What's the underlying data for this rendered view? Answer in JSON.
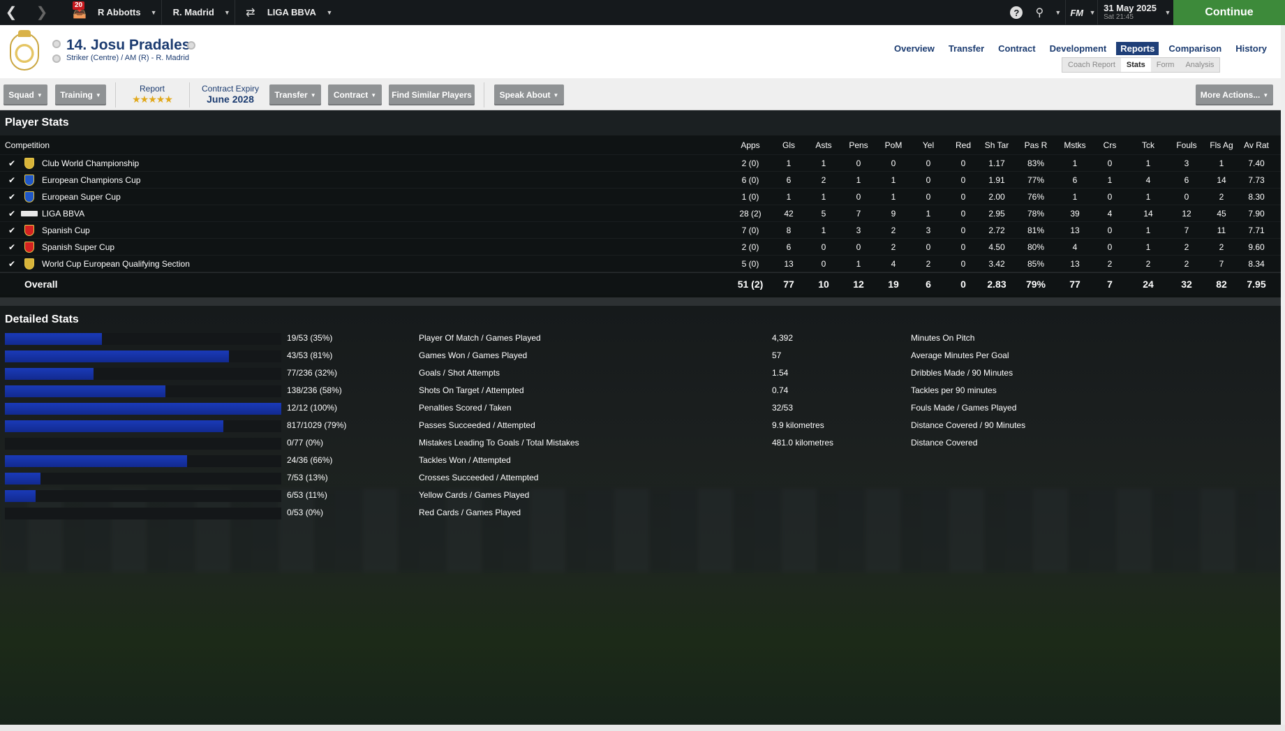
{
  "topbar": {
    "inbox_count": "20",
    "manager": "R Abbotts",
    "club": "R. Madrid",
    "competition": "LIGA BBVA",
    "fm_label": "FM",
    "date": "31 May 2025",
    "time": "Sat 21:45",
    "continue_label": "Continue"
  },
  "player": {
    "name": "14. Josu Pradales",
    "subtitle": "Striker (Centre) / AM (R) - R. Madrid"
  },
  "nav": {
    "overview": "Overview",
    "transfer": "Transfer",
    "contract": "Contract",
    "development": "Development",
    "reports": "Reports",
    "comparison": "Comparison",
    "history": "History"
  },
  "subtabs": {
    "coach_report": "Coach Report",
    "stats": "Stats",
    "form": "Form",
    "analysis": "Analysis"
  },
  "actions": {
    "squad": "Squad",
    "training": "Training",
    "report_label": "Report",
    "report_stars": "★★★★★",
    "contract_expiry_label": "Contract Expiry",
    "contract_expiry_value": "June 2028",
    "transfer": "Transfer",
    "contract": "Contract",
    "find_similar": "Find Similar Players",
    "speak_about": "Speak About",
    "more_actions": "More Actions..."
  },
  "player_stats": {
    "title": "Player Stats",
    "headers": [
      "Competition",
      "Apps",
      "Gls",
      "Asts",
      "Pens",
      "PoM",
      "Yel",
      "Red",
      "Sh Tar",
      "Pas R",
      "Mstks",
      "Crs",
      "Tck",
      "Fouls",
      "Fls Ag",
      "Av Rat"
    ],
    "rows": [
      {
        "name": "Club World Championship",
        "color": "#d8b43a",
        "vals": [
          "2 (0)",
          "1",
          "1",
          "0",
          "0",
          "0",
          "0",
          "1.17",
          "83%",
          "1",
          "0",
          "1",
          "3",
          "1",
          "7.40"
        ]
      },
      {
        "name": "European Champions Cup",
        "color": "#1f57c7",
        "vals": [
          "6 (0)",
          "6",
          "2",
          "1",
          "1",
          "0",
          "0",
          "1.91",
          "77%",
          "6",
          "1",
          "4",
          "6",
          "14",
          "7.73"
        ]
      },
      {
        "name": "European Super Cup",
        "color": "#1f57c7",
        "vals": [
          "1 (0)",
          "1",
          "1",
          "0",
          "1",
          "0",
          "0",
          "2.00",
          "76%",
          "1",
          "0",
          "1",
          "0",
          "2",
          "8.30"
        ]
      },
      {
        "name": "LIGA BBVA",
        "color": "#e8e8e8",
        "vals": [
          "28 (2)",
          "42",
          "5",
          "7",
          "9",
          "1",
          "0",
          "2.95",
          "78%",
          "39",
          "4",
          "14",
          "12",
          "45",
          "7.90"
        ]
      },
      {
        "name": "Spanish Cup",
        "color": "#d42121",
        "vals": [
          "7 (0)",
          "8",
          "1",
          "3",
          "2",
          "3",
          "0",
          "2.72",
          "81%",
          "13",
          "0",
          "1",
          "7",
          "11",
          "7.71"
        ]
      },
      {
        "name": "Spanish Super Cup",
        "color": "#d42121",
        "vals": [
          "2 (0)",
          "6",
          "0",
          "0",
          "2",
          "0",
          "0",
          "4.50",
          "80%",
          "4",
          "0",
          "1",
          "2",
          "2",
          "9.60"
        ]
      },
      {
        "name": "World Cup European Qualifying Section",
        "color": "#d8b43a",
        "vals": [
          "5 (0)",
          "13",
          "0",
          "1",
          "4",
          "2",
          "0",
          "3.42",
          "85%",
          "13",
          "2",
          "2",
          "2",
          "7",
          "8.34"
        ]
      }
    ],
    "overall_label": "Overall",
    "overall": [
      "51 (2)",
      "77",
      "10",
      "12",
      "19",
      "6",
      "0",
      "2.83",
      "79%",
      "77",
      "7",
      "24",
      "32",
      "82",
      "7.95"
    ]
  },
  "detailed_stats": {
    "title": "Detailed Stats",
    "left": [
      {
        "value": "19/53 (35%)",
        "label": "Player Of Match / Games Played",
        "fraction": 0.35
      },
      {
        "value": "43/53 (81%)",
        "label": "Games Won / Games Played",
        "fraction": 0.81
      },
      {
        "value": "77/236 (32%)",
        "label": "Goals / Shot Attempts",
        "fraction": 0.32
      },
      {
        "value": "138/236 (58%)",
        "label": "Shots On Target / Attempted",
        "fraction": 0.58
      },
      {
        "value": "12/12 (100%)",
        "label": "Penalties Scored / Taken",
        "fraction": 1.0
      },
      {
        "value": "817/1029 (79%)",
        "label": "Passes Succeeded / Attempted",
        "fraction": 0.79
      },
      {
        "value": "0/77 (0%)",
        "label": "Mistakes Leading To Goals / Total Mistakes",
        "fraction": 0
      },
      {
        "value": "24/36 (66%)",
        "label": "Tackles Won / Attempted",
        "fraction": 0.66
      },
      {
        "value": "7/53 (13%)",
        "label": "Crosses Succeeded / Attempted",
        "fraction": 0.13
      },
      {
        "value": "6/53 (11%)",
        "label": "Yellow Cards / Games Played",
        "fraction": 0.11
      },
      {
        "value": "0/53 (0%)",
        "label": "Red Cards / Games Played",
        "fraction": 0
      }
    ],
    "right": [
      {
        "value": "4,392",
        "label": "Minutes On Pitch"
      },
      {
        "value": "57",
        "label": "Average Minutes Per Goal"
      },
      {
        "value": "1.54",
        "label": "Dribbles Made / 90 Minutes"
      },
      {
        "value": "0.74",
        "label": "Tackles per 90 minutes"
      },
      {
        "value": "32/53",
        "label": "Fouls Made / Games Played"
      },
      {
        "value": "9.9 kilometres",
        "label": "Distance Covered / 90 Minutes"
      },
      {
        "value": "481.0 kilometres",
        "label": "Distance Covered"
      }
    ]
  }
}
